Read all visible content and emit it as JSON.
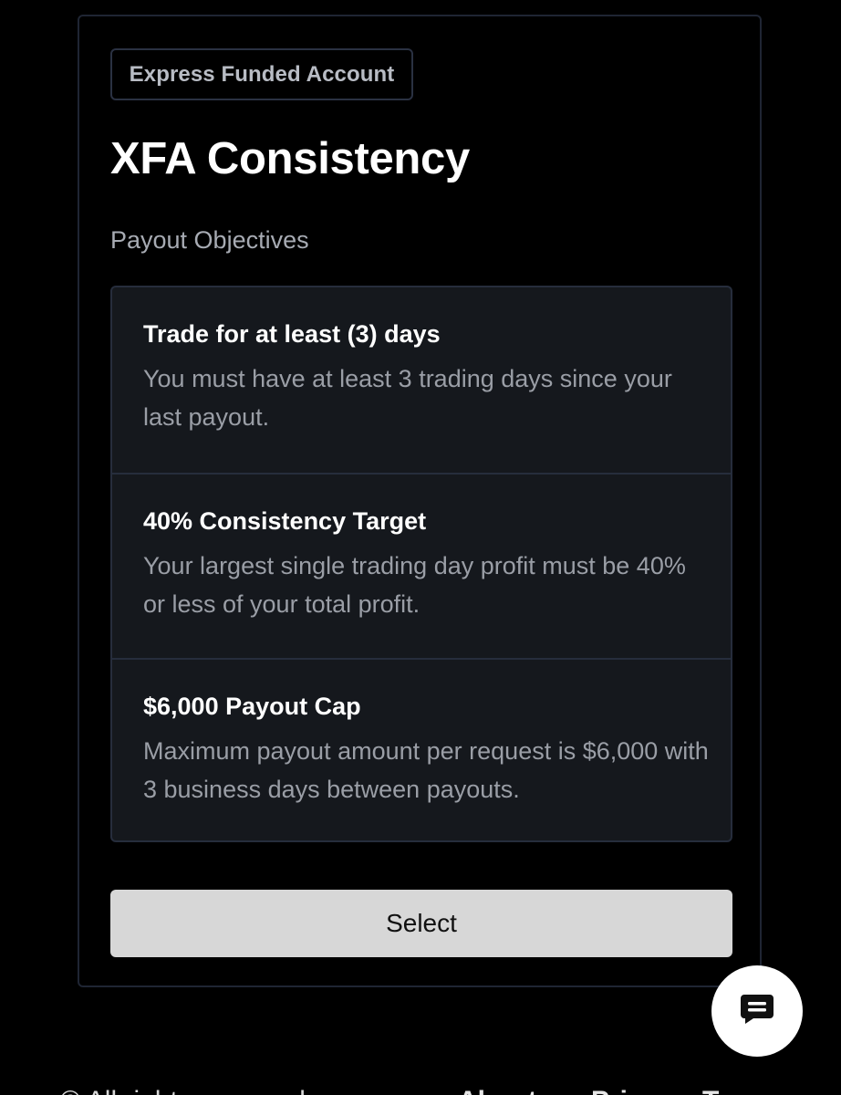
{
  "plan": {
    "badge": "Express Funded Account",
    "title": "XFA Consistency",
    "section_label": "Payout Objectives",
    "objectives": [
      {
        "title": "Trade for at least (3) days",
        "description": "You must have at least 3 trading days since your last payout."
      },
      {
        "title": "40% Consistency Target",
        "description": "Your largest single trading day profit must be 40% or less of your total profit."
      },
      {
        "title": "$6,000 Payout Cap",
        "description": "Maximum payout amount per request is $6,000 with 3 business days between payouts."
      }
    ],
    "select_label": "Select"
  },
  "chat": {
    "icon": "chat-bubble-icon"
  },
  "footer": {
    "copyright": "© All rights reserved",
    "links": [
      "About",
      "Privacy",
      "Terms"
    ]
  },
  "colors": {
    "background": "#000000",
    "card_border": "#1f2533",
    "objectives_bg": "#15181d",
    "select_button_bg": "#d7d7d7",
    "muted_text": "#9a9ea6"
  }
}
